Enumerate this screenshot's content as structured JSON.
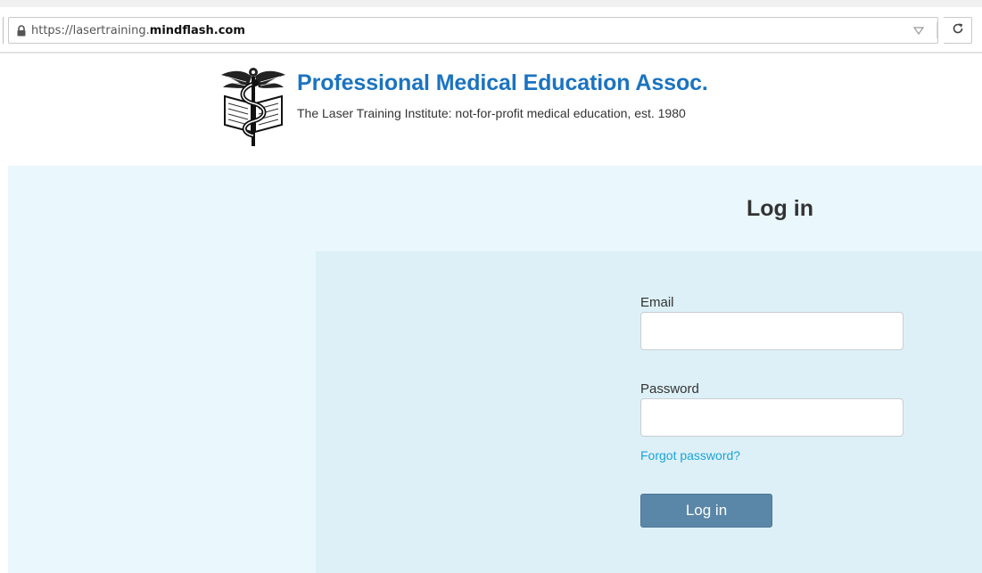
{
  "browser": {
    "url_prefix": "https://lasertraining.",
    "url_domain": "mindflash.com",
    "icons": [
      "lock-icon",
      "dropdown-arrow-icon",
      "reload-icon"
    ]
  },
  "header": {
    "org_title": "Professional Medical Education Assoc.",
    "org_subtitle": "The Laser Training Institute: not-for-profit medical education, est. 1980"
  },
  "login": {
    "heading": "Log in",
    "email_label": "Email",
    "email_value": "",
    "password_label": "Password",
    "password_value": "",
    "forgot_password": "Forgot password?",
    "submit_label": "Log in"
  },
  "colors": {
    "title_blue": "#1b73c0",
    "link_blue": "#1aa3d8",
    "button": "#5a86a8",
    "outer_panel": "#eaf7fc",
    "inner_panel": "#ddf0f7"
  }
}
